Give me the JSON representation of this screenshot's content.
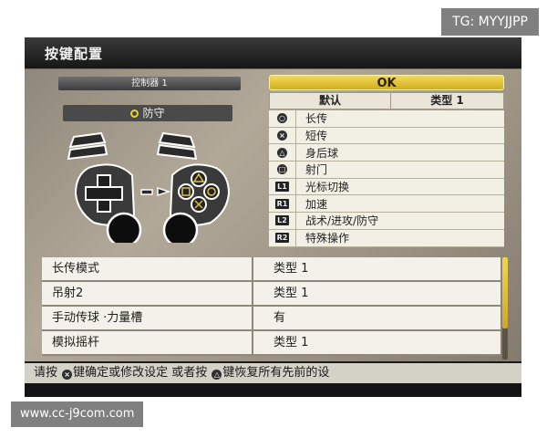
{
  "watermarks": {
    "top_right": "TG: MYYJJPP",
    "bottom_left": "www.cc-j9com.com"
  },
  "screen": {
    "title": "按键配置",
    "controller_label": "控制器 1",
    "preset": {
      "icon": "circle-icon",
      "label": "防守"
    },
    "ok_label": "OK",
    "header": {
      "left": "默认",
      "right": "类型 1"
    },
    "mappings": [
      {
        "icon": "circle-icon",
        "glyph": "○",
        "label": "长传"
      },
      {
        "icon": "cross-icon",
        "glyph": "×",
        "label": "短传"
      },
      {
        "icon": "triangle-icon",
        "glyph": "△",
        "label": "身后球"
      },
      {
        "icon": "square-icon",
        "glyph": "□",
        "label": "射门"
      },
      {
        "icon": "l1-icon",
        "glyph": "L1",
        "label": "光标切换"
      },
      {
        "icon": "r1-icon",
        "glyph": "R1",
        "label": "加速"
      },
      {
        "icon": "l2-icon",
        "glyph": "L2",
        "label": "战术/进攻/防守"
      },
      {
        "icon": "r2-icon",
        "glyph": "R2",
        "label": "特殊操作"
      }
    ],
    "options": [
      {
        "name": "长传模式",
        "value": "类型 1"
      },
      {
        "name": "吊射2",
        "value": "类型 1"
      },
      {
        "name": "手动传球 ·力量槽",
        "value": "有"
      },
      {
        "name": "模拟摇杆",
        "value": "类型 1"
      }
    ],
    "help": {
      "part1": "请按 ",
      "icon1": "cross-icon",
      "part2": "键确定或修改设定 或者按 ",
      "icon2": "triangle-icon",
      "part3": "键恢复所有先前的设"
    }
  },
  "colors": {
    "accent": "#e1c23a",
    "background": "#1b1b1b",
    "row_bg": "#f3f1ea"
  }
}
